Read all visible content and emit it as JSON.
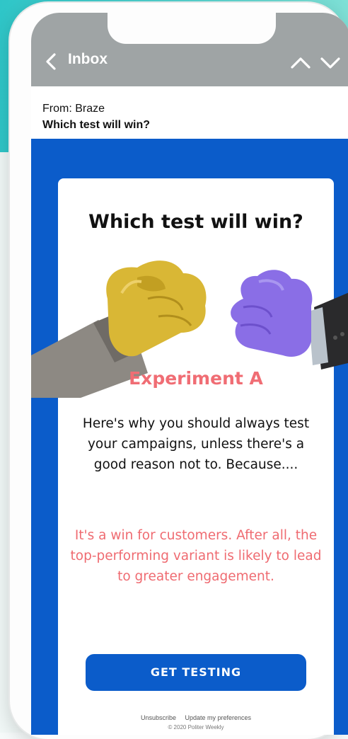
{
  "header": {
    "back_label": "Inbox",
    "back_icon": "chevron-left-icon",
    "prev_icon": "chevron-up-icon",
    "next_icon": "chevron-down-icon"
  },
  "email": {
    "from": "From: Braze",
    "subject": "Which test will win?"
  },
  "card": {
    "title": "Which test will win?",
    "experiment_title": "Experiment A",
    "body": "Here's why you should always test your campaigns, unless there's a good reason not to. Because....",
    "highlight": "It's a win for customers. After all, the top-performing variant is likely to lead to greater engagement.",
    "cta_label": "GET TESTING",
    "footer": {
      "unsubscribe": "Unsubscribe",
      "preferences": "Update my preferences",
      "copyright": "© 2020 Politer Weekly"
    }
  },
  "colors": {
    "brand_blue": "#0b5cca",
    "accent_pink": "#ef6b71",
    "header_gray": "#9fa4a5",
    "teal": "#2fc6c8"
  }
}
